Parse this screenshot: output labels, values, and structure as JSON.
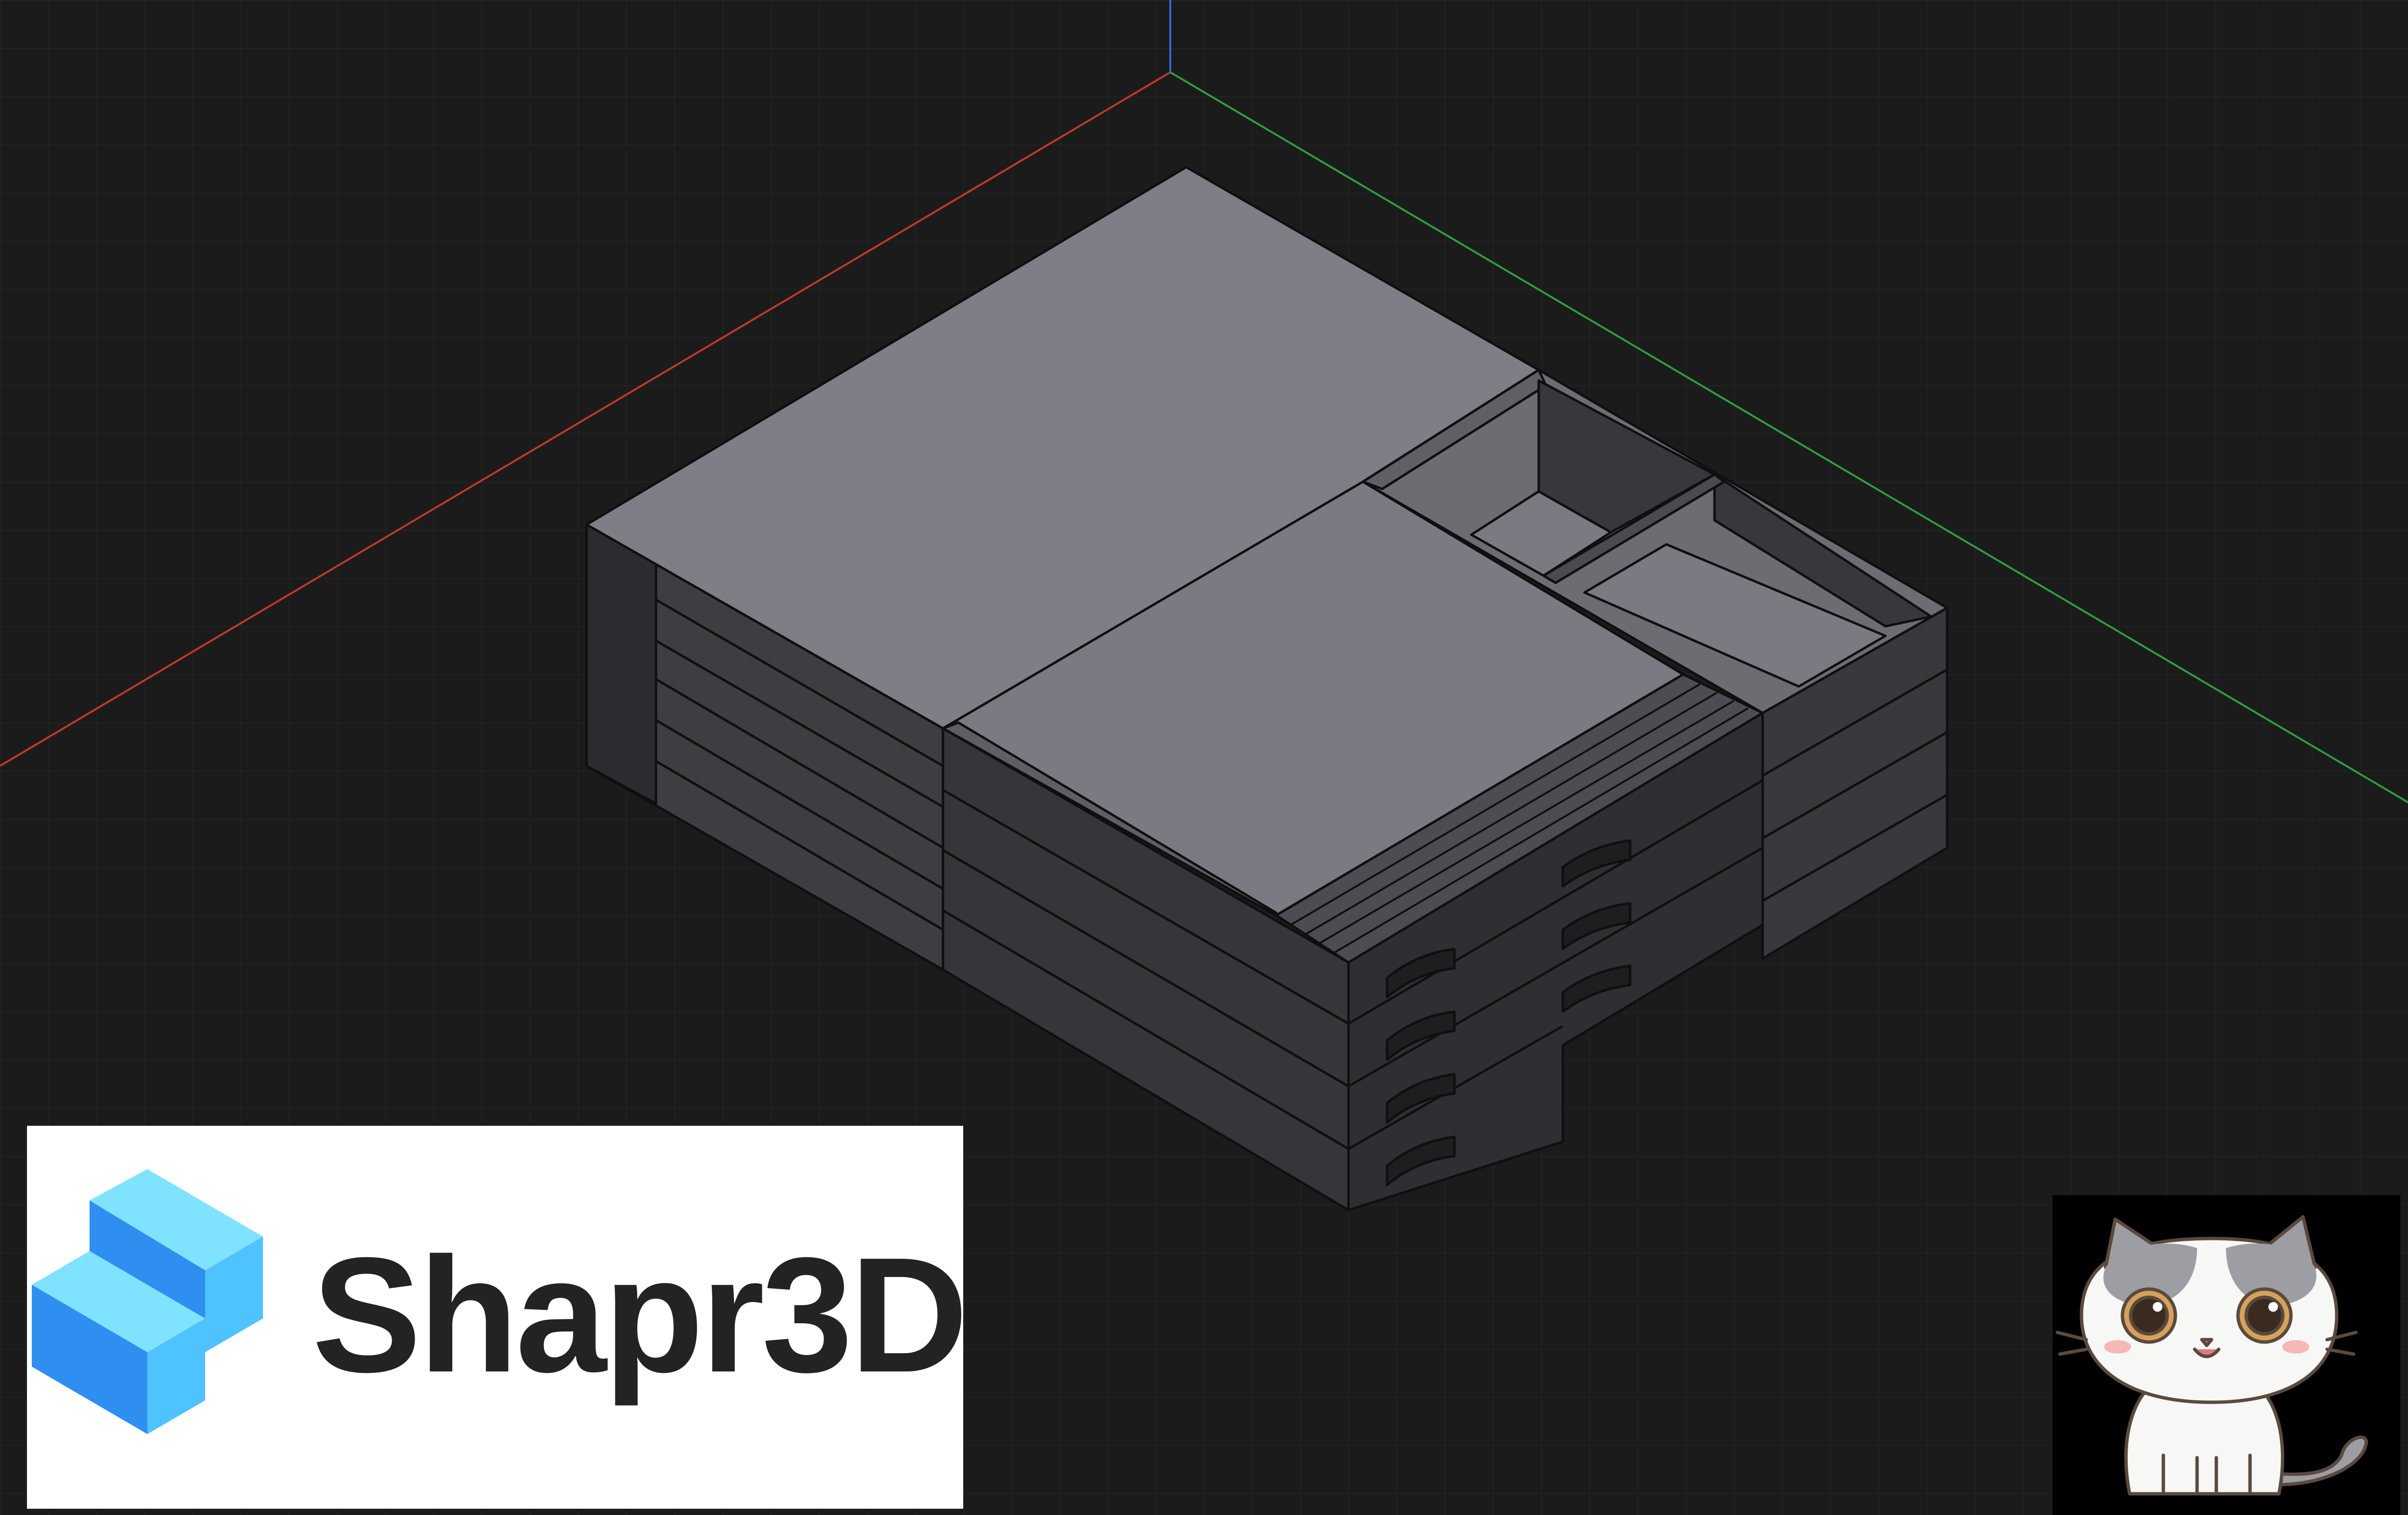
{
  "app": {
    "name": "Shapr3D"
  },
  "viewport": {
    "background": "#1b1b1c",
    "grid": true,
    "grid_color": "#2a2a2c",
    "axes": {
      "x": {
        "color": "#c0392b",
        "icon": "x-axis-line"
      },
      "y": {
        "color": "#2e9e3f",
        "icon": "y-axis-line"
      },
      "z": {
        "color": "#2f6bd6",
        "icon": "z-axis-line"
      }
    },
    "model": {
      "description_icon": "isometric-drawer-box-model",
      "face_colors": {
        "top": "#7e7f86",
        "left": "#3f3f44",
        "right": "#333337",
        "interior": "#5a5a60"
      },
      "edge_color": "#0f0f10"
    }
  },
  "logo": {
    "text": "Shapr3D",
    "icon": "shapr3d-cube-icon",
    "brand_colors": [
      "#4fc3ff",
      "#2f8ff0",
      "#7fe3ff"
    ]
  },
  "mascot": {
    "icon": "cartoon-cat-sticker",
    "background": "#000000"
  }
}
